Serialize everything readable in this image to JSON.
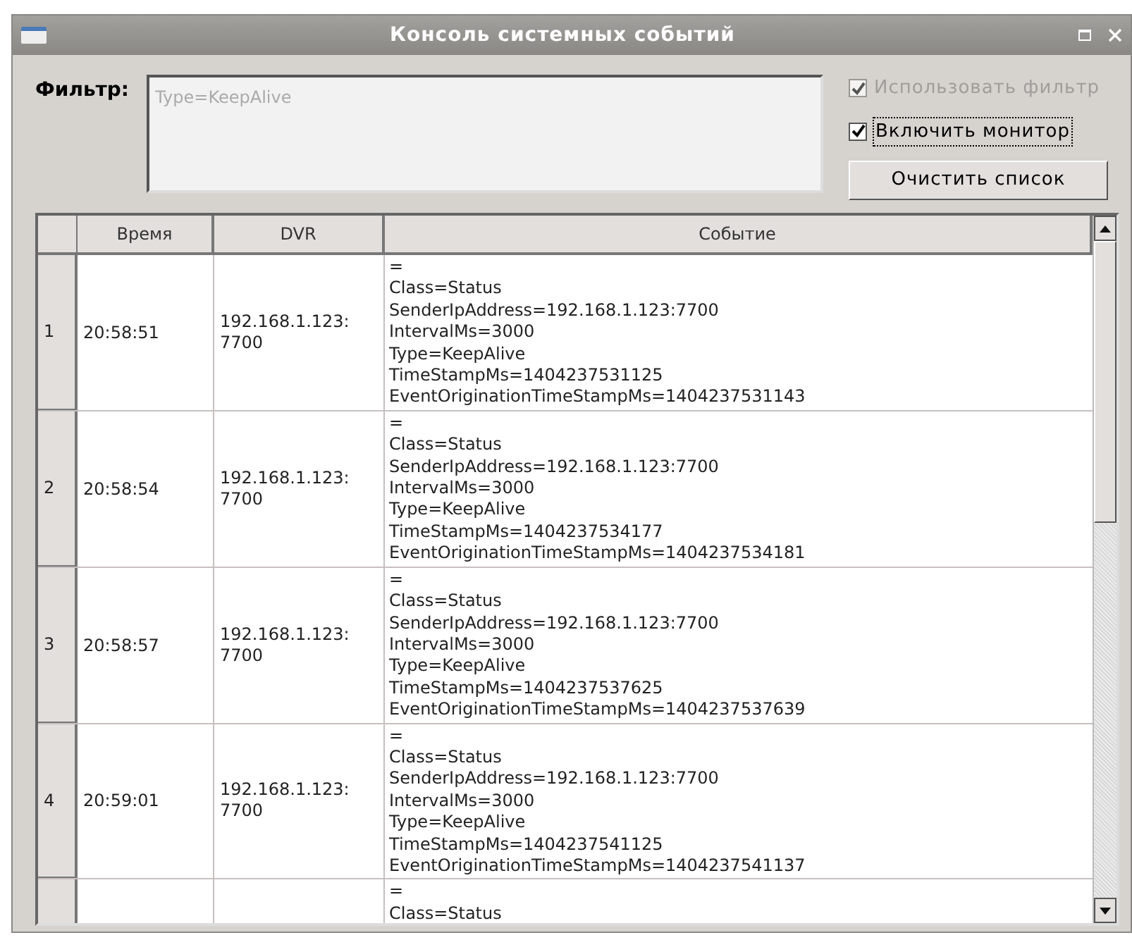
{
  "window": {
    "title": "Консоль системных событий"
  },
  "filter": {
    "label": "Фильтр:",
    "placeholder": "Type=KeepAlive"
  },
  "options": [
    {
      "label": "Использовать фильтр",
      "checked": true,
      "disabled": true
    },
    {
      "label": "Включить монитор",
      "checked": true,
      "disabled": false
    }
  ],
  "clear_button": "Очистить список",
  "table": {
    "columns": [
      "Время",
      "DVR",
      "Событие"
    ],
    "rows": [
      {
        "number": "1",
        "time": "20:58:51",
        "dvr": "192.168.1.123:\n7700",
        "event": [
          "=",
          "Class=Status",
          "SenderIpAddress=192.168.1.123:7700",
          "IntervalMs=3000",
          "Type=KeepAlive",
          "TimeStampMs=1404237531125",
          "EventOriginationTimeStampMs=1404237531143"
        ]
      },
      {
        "number": "2",
        "time": "20:58:54",
        "dvr": "192.168.1.123:\n7700",
        "event": [
          "=",
          "Class=Status",
          "SenderIpAddress=192.168.1.123:7700",
          "IntervalMs=3000",
          "Type=KeepAlive",
          "TimeStampMs=1404237534177",
          "EventOriginationTimeStampMs=1404237534181"
        ]
      },
      {
        "number": "3",
        "time": "20:58:57",
        "dvr": "192.168.1.123:\n7700",
        "event": [
          "=",
          "Class=Status",
          "SenderIpAddress=192.168.1.123:7700",
          "IntervalMs=3000",
          "Type=KeepAlive",
          "TimeStampMs=1404237537625",
          "EventOriginationTimeStampMs=1404237537639"
        ]
      },
      {
        "number": "4",
        "time": "20:59:01",
        "dvr": "192.168.1.123:\n7700",
        "event": [
          "=",
          "Class=Status",
          "SenderIpAddress=192.168.1.123:7700",
          "IntervalMs=3000",
          "Type=KeepAlive",
          "TimeStampMs=1404237541125",
          "EventOriginationTimeStampMs=1404237541137"
        ]
      },
      {
        "event": [
          "=",
          "Class=Status"
        ]
      }
    ]
  }
}
